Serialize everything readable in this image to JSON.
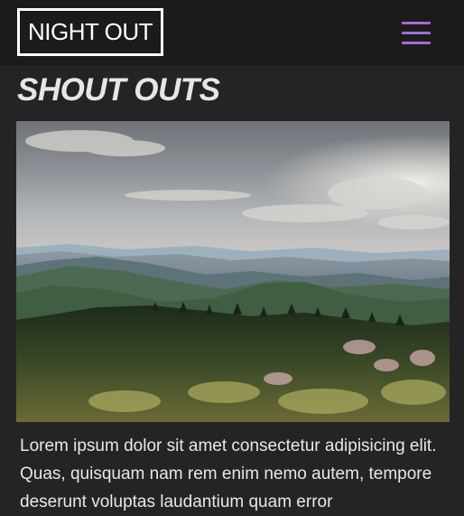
{
  "header": {
    "logo_text": "NIGHT OUT",
    "menu_icon": "hamburger-menu-icon",
    "accent_color": "#a36bd6"
  },
  "section": {
    "title": "SHOUT OUTS"
  },
  "feature": {
    "image": "mountain-landscape-photo",
    "text": "Lorem ipsum dolor sit amet consectetur adipisicing elit. Quas, quisquam nam rem enim nemo autem, tempore deserunt voluptas laudantium quam error"
  }
}
